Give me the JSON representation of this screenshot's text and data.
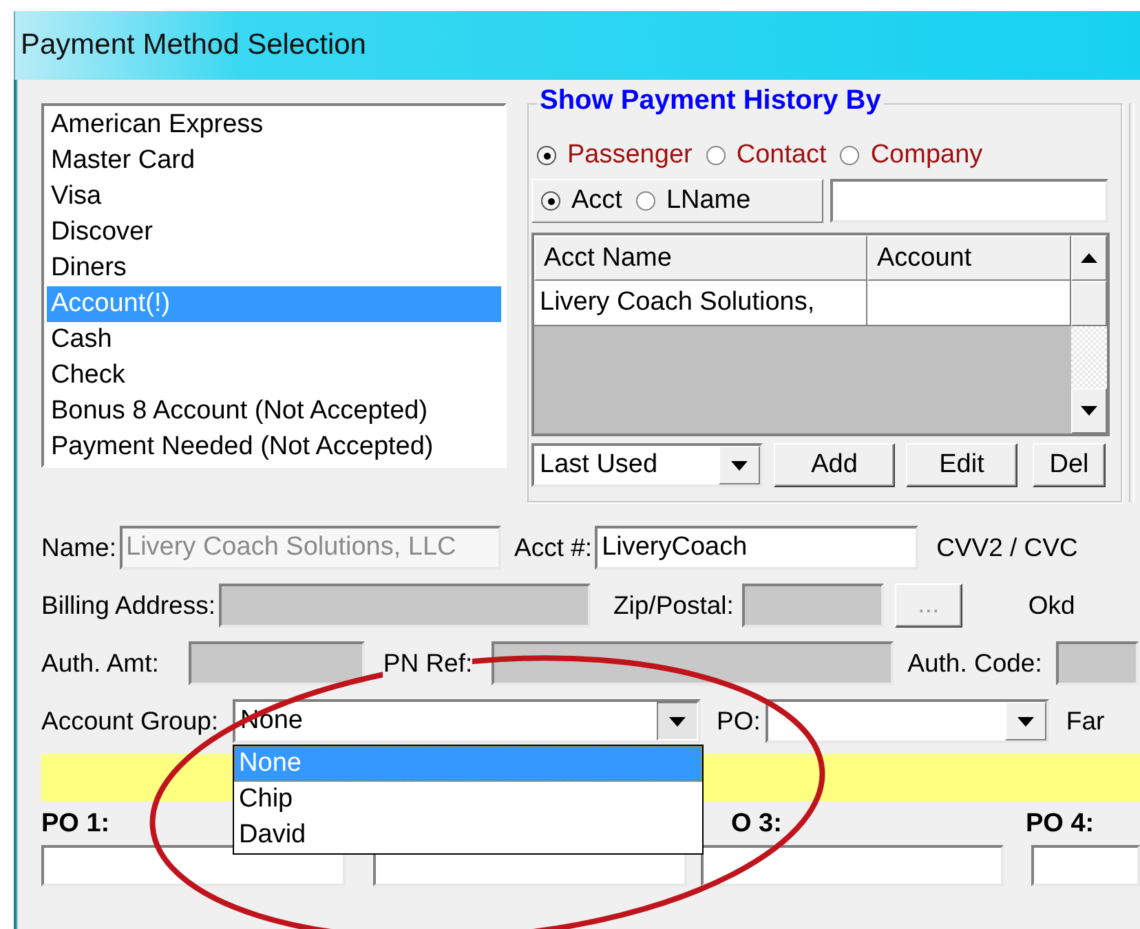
{
  "window": {
    "title": "Payment Method Selection"
  },
  "payment_methods": [
    {
      "label": "American Express",
      "selected": false
    },
    {
      "label": "Master Card",
      "selected": false
    },
    {
      "label": "Visa",
      "selected": false
    },
    {
      "label": "Discover",
      "selected": false
    },
    {
      "label": "Diners",
      "selected": false
    },
    {
      "label": "Account(!)",
      "selected": true
    },
    {
      "label": "Cash",
      "selected": false
    },
    {
      "label": "Check",
      "selected": false
    },
    {
      "label": "Bonus 8 Account (Not Accepted)",
      "selected": false
    },
    {
      "label": "Payment Needed (Not Accepted)",
      "selected": false
    }
  ],
  "history": {
    "title": "Show Payment History By",
    "filter_options": [
      {
        "label": "Passenger",
        "selected": true
      },
      {
        "label": "Contact",
        "selected": false
      },
      {
        "label": "Company",
        "selected": false
      }
    ],
    "search_options": [
      {
        "label": "Acct",
        "selected": true
      },
      {
        "label": "LName",
        "selected": false
      }
    ],
    "table": {
      "columns": [
        "Acct Name",
        "Account"
      ],
      "rows": [
        {
          "acct_name": "Livery Coach Solutions,"
        }
      ]
    },
    "sort": {
      "value": "Last Used"
    },
    "buttons": [
      "Add",
      "Edit",
      "Del"
    ]
  },
  "details": {
    "name": {
      "label": "Name:",
      "value": "Livery Coach Solutions, LLC",
      "disabled": true
    },
    "acct_no": {
      "label": "Acct #:",
      "value": "LiveryCoach",
      "disabled": false
    },
    "cvv_label": "CVV2 / CVC",
    "billing_address": {
      "label": "Billing Address:",
      "disabled": true
    },
    "zip": {
      "label": "Zip/Postal:",
      "disabled": true
    },
    "zip_lookup_button": {
      "label": "...",
      "disabled": true
    },
    "okd_label": {
      "text": "Okd"
    },
    "auth_amt": {
      "label": "Auth. Amt:",
      "disabled": true
    },
    "pn_ref": {
      "label": "PN Ref:",
      "disabled": true
    },
    "auth_code": {
      "label": "Auth. Code:",
      "disabled": true
    },
    "account_group": {
      "label": "Account Group:",
      "value": "None",
      "expanded": true,
      "options": [
        {
          "label": "None",
          "selected": true
        },
        {
          "label": "Chip",
          "selected": false
        },
        {
          "label": "David",
          "selected": false
        }
      ]
    },
    "po": {
      "label": "PO:"
    },
    "far_label": "Far"
  },
  "po_labels": [
    "PO 1:",
    "O 3:",
    "PO 4:"
  ]
}
